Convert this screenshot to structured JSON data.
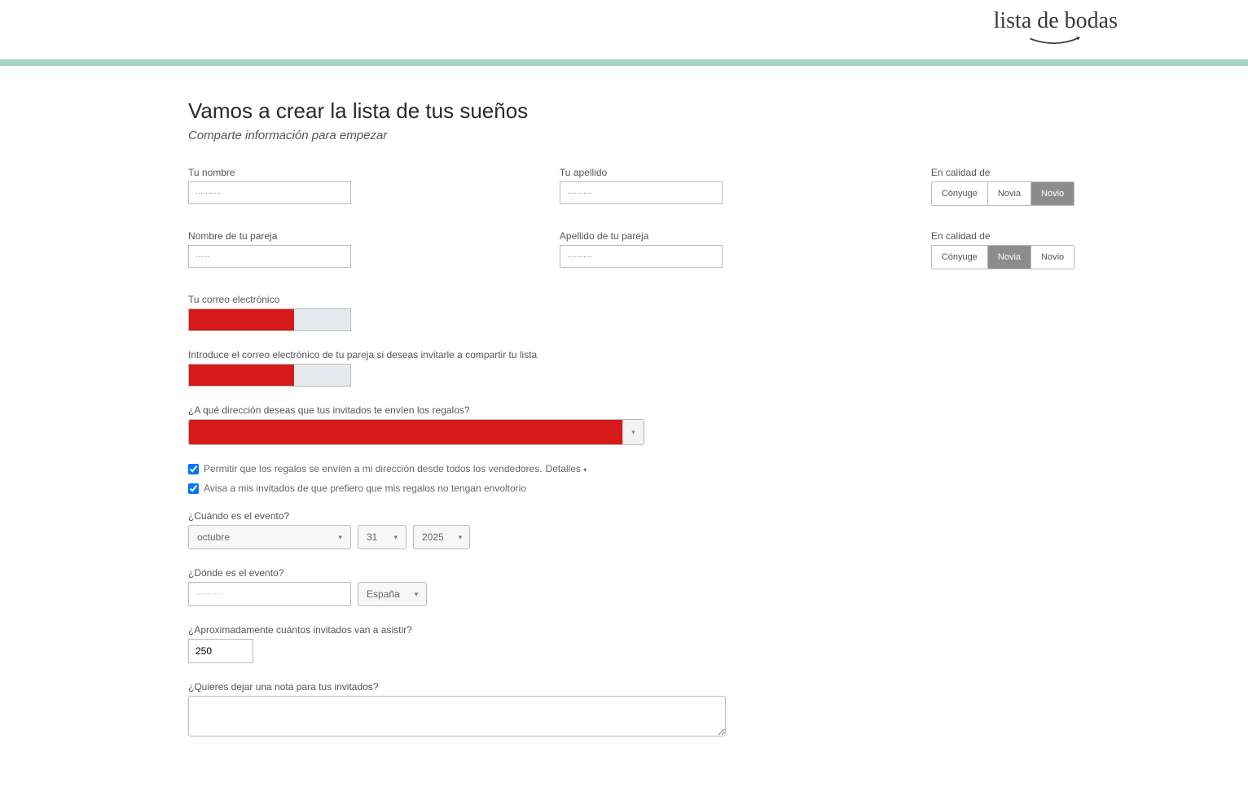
{
  "header": {
    "brand": "lista de bodas"
  },
  "page": {
    "title": "Vamos a crear la lista de tus sueños",
    "subtitle": "Comparte información para empezar"
  },
  "labels": {
    "tu_nombre": "Tu nombre",
    "tu_apellido": "Tu apellido",
    "nombre_pareja": "Nombre de tu pareja",
    "apellido_pareja": "Apellido de tu pareja",
    "en_calidad_de_1": "En calidad de",
    "en_calidad_de_2": "En calidad de",
    "correo": "Tu correo electrónico",
    "correo_pareja": "Introduce el correo electrónico de tu pareja si deseas invitarle a compartir tu lista",
    "direccion": "¿A qué dirección deseas que tus invitados te envíen los regalos?",
    "perm_regalos": "Permitir que los regalos se envíen a mi dirección desde todos los vendedores.",
    "detalles": "Detalles",
    "aviso_env": "Avisa a mis invitados de que prefiero que mis regalos no tengan envoltorio",
    "cuando": "¿Cuándo es el evento?",
    "donde": "¿Dónde es el evento?",
    "invitados": "¿Aproximadamente cuántos invitados van a asistir?",
    "nota": "¿Quieres dejar una nota para tus invitados?"
  },
  "values": {
    "tu_nombre": "···········",
    "tu_apellido": "···········",
    "nombre_pareja": "······",
    "apellido_pareja": "···········",
    "city": "·········",
    "guests": "250",
    "month": "octubre",
    "day": "31",
    "year": "2025",
    "country": "España"
  },
  "role_buttons": {
    "conyuge": "Cónyuge",
    "novia": "Novia",
    "novio": "Novio"
  }
}
